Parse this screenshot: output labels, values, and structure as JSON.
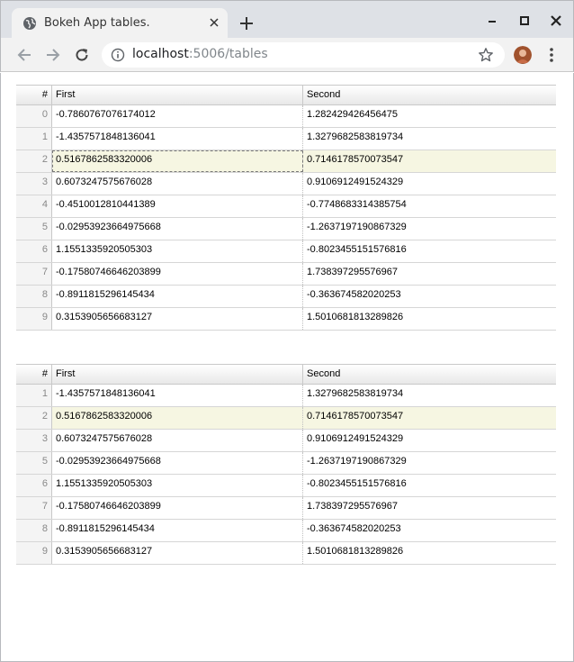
{
  "browser": {
    "tab_title": "Bokeh App tables.",
    "url_host": "localhost",
    "url_rest": ":5006/tables"
  },
  "icons": [
    "globe-icon",
    "close-icon",
    "plus-icon",
    "minimize-icon",
    "maximize-icon",
    "window-close-icon",
    "back-arrow-icon",
    "forward-arrow-icon",
    "reload-icon",
    "info-icon",
    "star-icon",
    "avatar",
    "kebab-menu-icon"
  ],
  "colors": {
    "selected_row": "#f6f6e2",
    "header_gradient_end": "#e8e8e8",
    "chrome": "#dee1e6"
  },
  "table1": {
    "headers": {
      "index": "#",
      "first": "First",
      "second": "Second"
    },
    "rows": [
      {
        "index": "0",
        "first": "-0.7860767076174012",
        "second": "1.282429426456475"
      },
      {
        "index": "1",
        "first": "-1.4357571848136041",
        "second": "1.3279682583819734"
      },
      {
        "index": "2",
        "first": "0.5167862583320006",
        "second": "0.7146178570073547"
      },
      {
        "index": "3",
        "first": "0.6073247575676028",
        "second": "0.9106912491524329"
      },
      {
        "index": "4",
        "first": "-0.4510012810441389",
        "second": "-0.7748683314385754"
      },
      {
        "index": "5",
        "first": "-0.02953923664975668",
        "second": "-1.2637197190867329"
      },
      {
        "index": "6",
        "first": "1.1551335920505303",
        "second": "-0.8023455151576816"
      },
      {
        "index": "7",
        "first": "-0.17580746646203899",
        "second": "1.738397295576967"
      },
      {
        "index": "8",
        "first": "-0.8911815296145434",
        "second": "-0.363674582020253"
      },
      {
        "index": "9",
        "first": "0.3153905656683127",
        "second": "1.5010681813289826"
      }
    ]
  },
  "table2": {
    "headers": {
      "index": "#",
      "first": "First",
      "second": "Second"
    },
    "rows": [
      {
        "index": "1",
        "first": "-1.4357571848136041",
        "second": "1.3279682583819734"
      },
      {
        "index": "2",
        "first": "0.5167862583320006",
        "second": "0.7146178570073547"
      },
      {
        "index": "3",
        "first": "0.6073247575676028",
        "second": "0.9106912491524329"
      },
      {
        "index": "5",
        "first": "-0.02953923664975668",
        "second": "-1.2637197190867329"
      },
      {
        "index": "6",
        "first": "1.1551335920505303",
        "second": "-0.8023455151576816"
      },
      {
        "index": "7",
        "first": "-0.17580746646203899",
        "second": "1.738397295576967"
      },
      {
        "index": "8",
        "first": "-0.8911815296145434",
        "second": "-0.363674582020253"
      },
      {
        "index": "9",
        "first": "0.3153905656683127",
        "second": "1.5010681813289826"
      }
    ]
  }
}
